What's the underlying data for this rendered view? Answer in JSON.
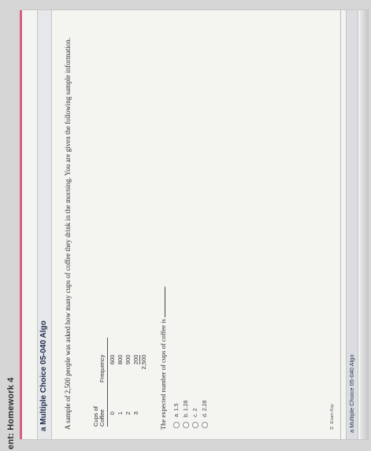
{
  "app": {
    "title": "ent: Homework 4"
  },
  "question": {
    "header_title": "a Multiple Choice 05-040 Algo",
    "prompt": "A sample of 2,500 people was asked how many cups of coffee they drink in the morning. You are given the following sample information.",
    "table": {
      "headers": [
        "Cups of Coffee",
        "Frequency"
      ],
      "rows": [
        {
          "cups": "0",
          "freq": "600"
        },
        {
          "cups": "1",
          "freq": "800"
        },
        {
          "cups": "2",
          "freq": "900"
        },
        {
          "cups": "3",
          "freq": "200"
        }
      ],
      "total": "2,500"
    },
    "stem": "The expected number of cups of coffee is",
    "choices": [
      {
        "label": "a. 1.5"
      },
      {
        "label": "b. 1.28"
      },
      {
        "label": "c. 2"
      },
      {
        "label": "d. 2.28"
      }
    ],
    "answer_key_label": "Exam Key",
    "footer_title": "a Multiple Choice 05-040 Algo"
  },
  "colors": {
    "accent": "#d95d80",
    "header_bg": "#e6e7ea",
    "panel_bg": "#f4f4f1"
  }
}
